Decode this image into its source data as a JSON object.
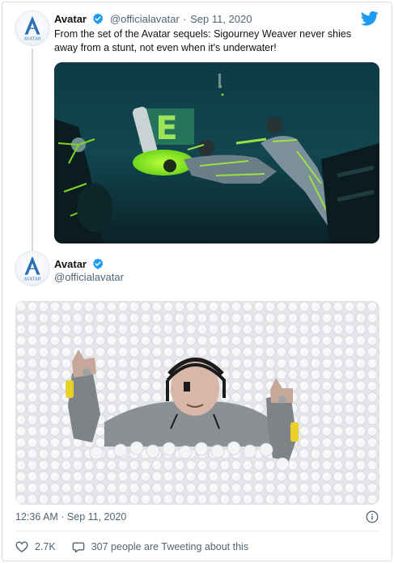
{
  "tweet1": {
    "author_name": "Avatar",
    "handle": "@officialavatar",
    "separator": "·",
    "date": "Sep 11, 2020",
    "text": "From the set of the Avatar sequels: Sigourney Weaver never shies away from a stunt, not even when it's underwater!",
    "media_alt": "underwater-motion-capture-photo"
  },
  "tweet2": {
    "author_name": "Avatar",
    "handle": "@officialavatar",
    "media_alt": "ball-pit-thumbs-up-photo"
  },
  "logo_text": "AVATAR",
  "timestamp": "12:36 AM · Sep 11, 2020",
  "footer": {
    "likes": "2.7K",
    "tweeting": "307 people are Tweeting about this"
  },
  "colors": {
    "twitter_blue": "#1d9bf0",
    "text_secondary": "#536471",
    "like_red": "#536471"
  },
  "icons": [
    "twitter-bird-icon",
    "verified-badge-icon",
    "info-icon",
    "heart-icon",
    "speech-bubble-icon"
  ]
}
